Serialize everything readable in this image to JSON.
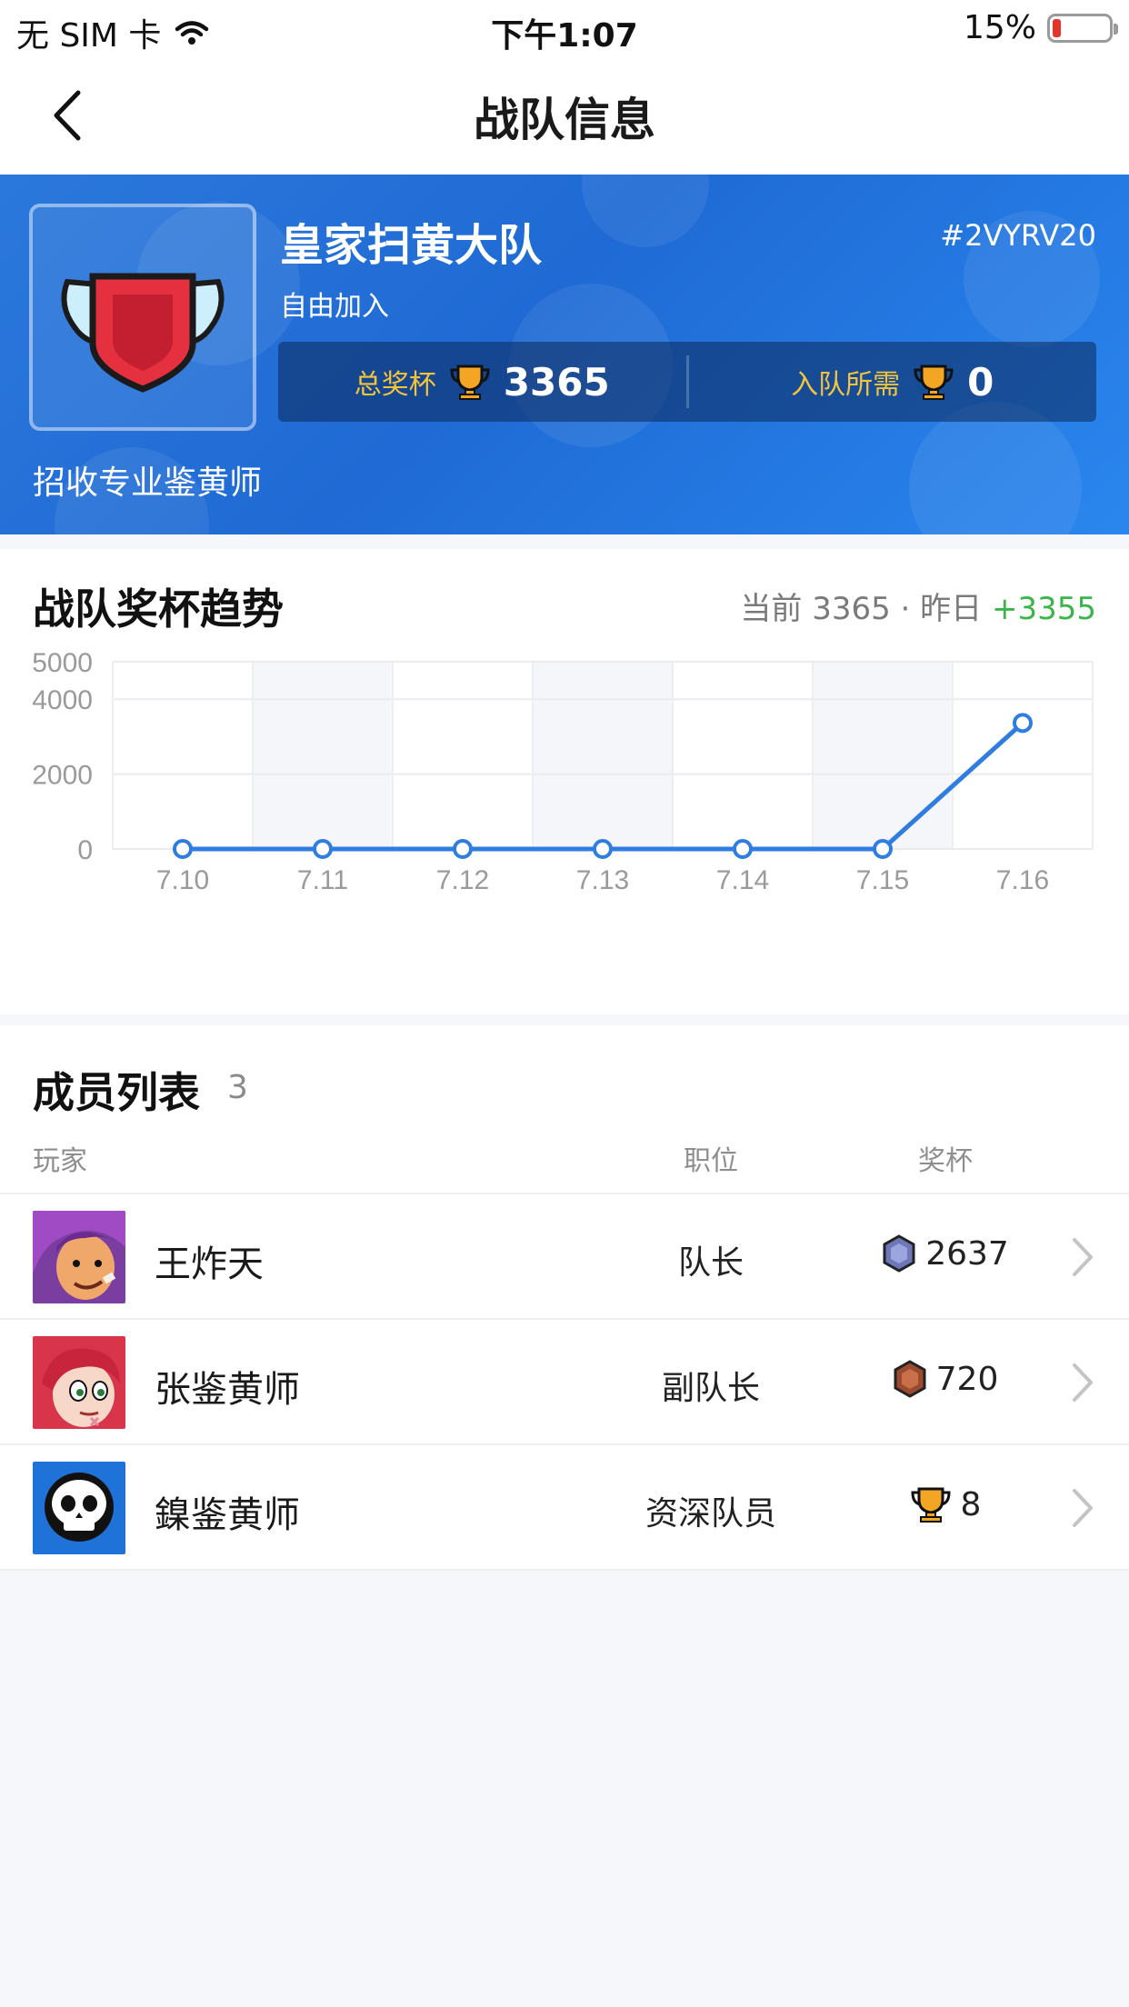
{
  "status_bar": {
    "carrier": "无 SIM 卡",
    "time": "下午1:07",
    "battery_percent": "15%",
    "battery_level": 0.15
  },
  "nav": {
    "title": "战队信息",
    "back_icon": "chevron-left-icon"
  },
  "team": {
    "name": "皇家扫黄大队",
    "tag": "#2VYRV20",
    "join_type": "自由加入",
    "description": "招收专业鉴黄师",
    "badge_icon": "winged-shield-icon",
    "total_trophies_label": "总奖杯",
    "total_trophies": "3365",
    "required_label": "入队所需",
    "required_trophies": "0",
    "trophy_icon": "trophy-icon"
  },
  "trend": {
    "title": "战队奖杯趋势",
    "current_label": "当前",
    "current_value": "3365",
    "separator": "·",
    "yesterday_label": "昨日",
    "delta": "+3355",
    "delta_color": "#3bb44a"
  },
  "chart_data": {
    "type": "line",
    "categories": [
      "7.10",
      "7.11",
      "7.12",
      "7.13",
      "7.14",
      "7.15",
      "7.16"
    ],
    "values": [
      0,
      0,
      0,
      0,
      0,
      0,
      3365
    ],
    "y_ticks": [
      "0",
      "2000",
      "4000",
      "5000"
    ],
    "ylim": [
      0,
      5000
    ],
    "grid": true,
    "line_color": "#2f7de1",
    "title": "",
    "xlabel": "",
    "ylabel": ""
  },
  "members": {
    "title": "成员列表",
    "count": "3",
    "columns": {
      "player": "玩家",
      "role": "职位",
      "trophies": "奖杯"
    },
    "rows": [
      {
        "name": "王炸天",
        "role": "队长",
        "trophies": "2637",
        "rank_icon": "silver-rank-icon",
        "avatar_icon": "brawler-shelly-avatar"
      },
      {
        "name": "张鉴黄师",
        "role": "副队长",
        "trophies": "720",
        "rank_icon": "bronze-rank-icon",
        "avatar_icon": "brawler-colt-avatar"
      },
      {
        "name": "鎳鉴黄师",
        "role": "资深队员",
        "trophies": "8",
        "rank_icon": "trophy-icon",
        "avatar_icon": "skull-avatar"
      }
    ]
  }
}
